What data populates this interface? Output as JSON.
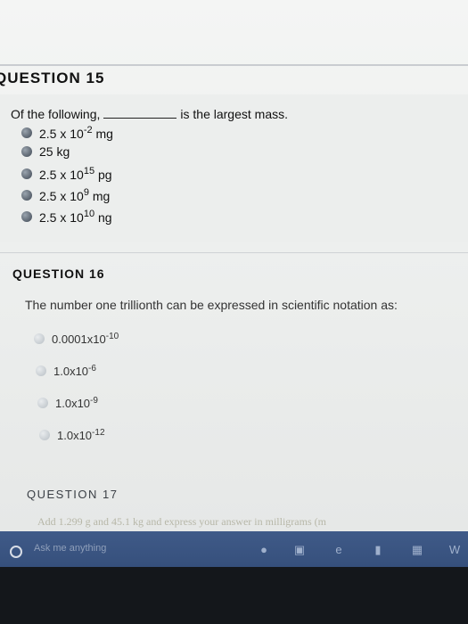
{
  "q15": {
    "title": "QUESTION 15",
    "prompt_start": "Of the following,",
    "prompt_end": "is the largest mass.",
    "options": [
      {
        "mantissa": "2.5 x 10",
        "exp": "-2",
        "unit": " mg"
      },
      {
        "mantissa": "25 kg",
        "exp": "",
        "unit": ""
      },
      {
        "mantissa": "2.5 x 10",
        "exp": "15",
        "unit": " pg"
      },
      {
        "mantissa": "2.5 x 10",
        "exp": "9",
        "unit": " mg"
      },
      {
        "mantissa": "2.5 x 10",
        "exp": "10",
        "unit": " ng"
      }
    ]
  },
  "q16": {
    "title": "QUESTION 16",
    "prompt": "The number one trillionth can be expressed in scientific notation as:",
    "options": [
      {
        "base": "0.0001x10",
        "exp": "-10"
      },
      {
        "base": "1.0x10",
        "exp": "-6"
      },
      {
        "base": "1.0x10",
        "exp": "-9"
      },
      {
        "base": "1.0x10",
        "exp": "-12"
      }
    ]
  },
  "q17": {
    "title": "QUESTION 17",
    "prompt": "Add 1.299 g and 45.1 kg and express your answer in milligrams (m"
  },
  "taskbar": {
    "search_placeholder": "Ask me anything",
    "icons": [
      "mic-icon",
      "task-view-icon",
      "edge-icon",
      "file-explorer-icon",
      "store-icon",
      "office-icon"
    ]
  }
}
